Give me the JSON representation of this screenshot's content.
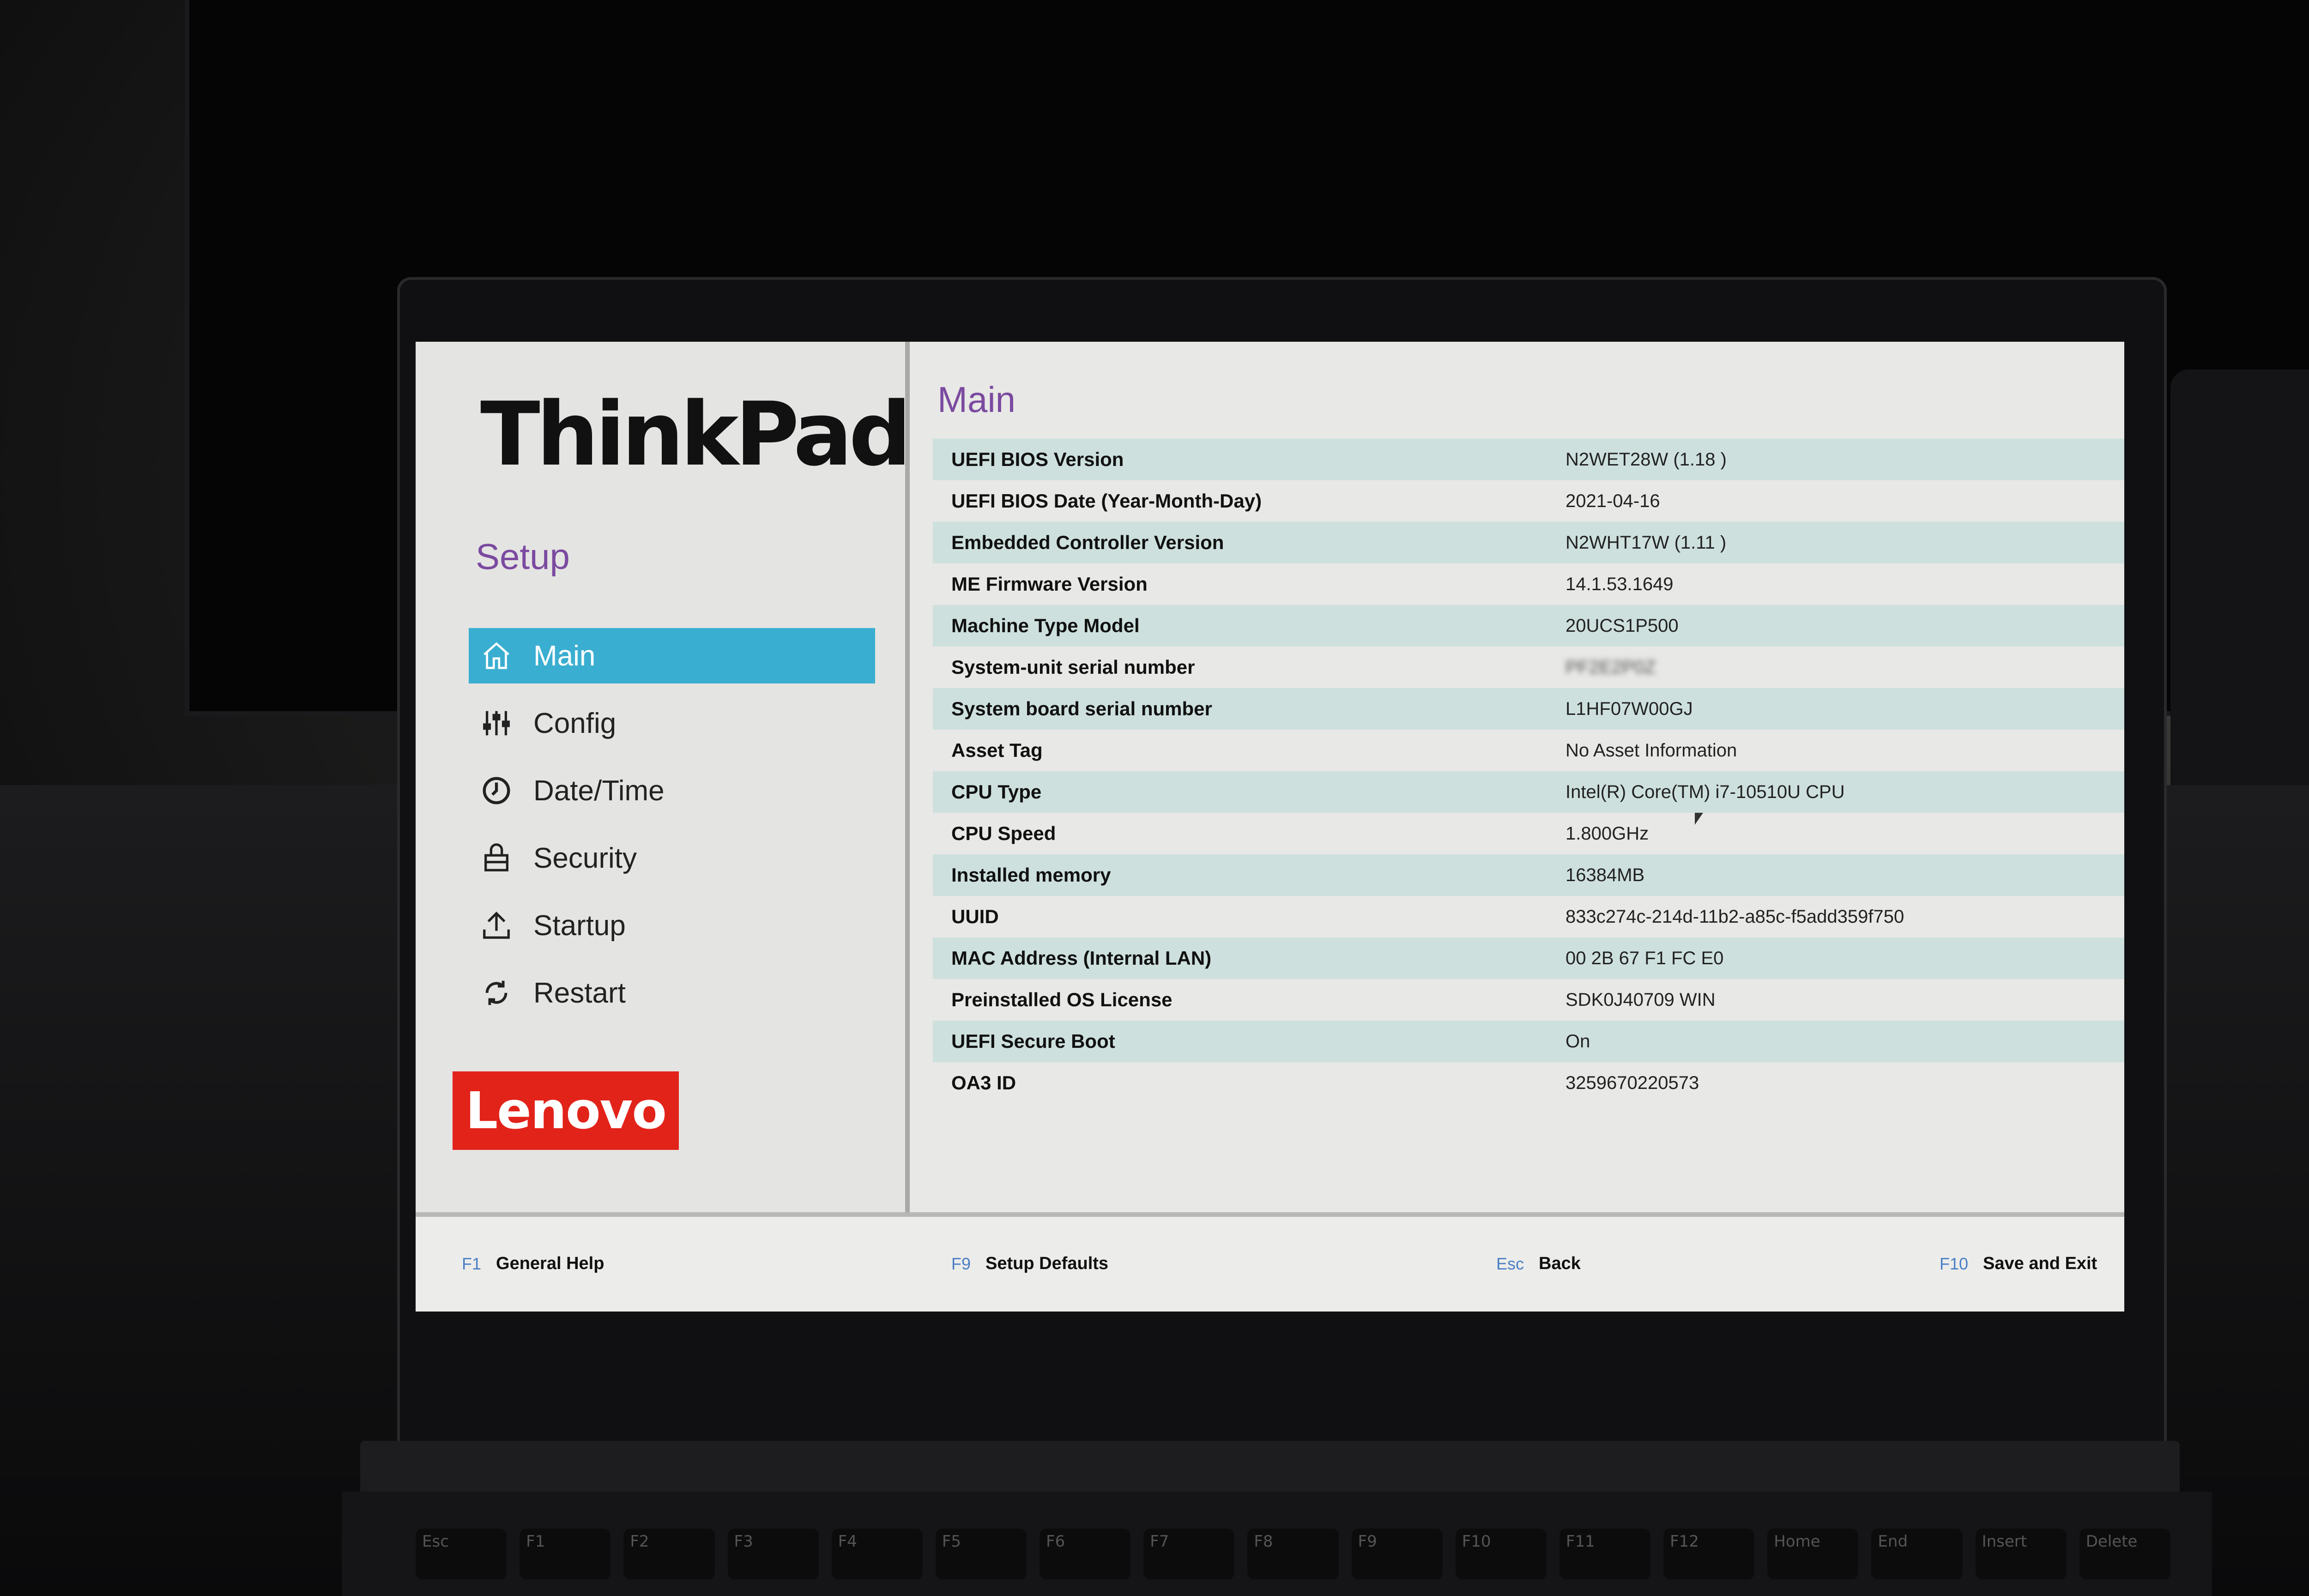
{
  "brand": {
    "name": "ThinkPad",
    "manufacturer_logo": "Lenovo"
  },
  "sidebar": {
    "title": "Setup",
    "items": [
      {
        "label": "Main",
        "icon": "home-icon",
        "active": true
      },
      {
        "label": "Config",
        "icon": "sliders-icon",
        "active": false
      },
      {
        "label": "Date/Time",
        "icon": "clock-icon",
        "active": false
      },
      {
        "label": "Security",
        "icon": "lock-icon",
        "active": false
      },
      {
        "label": "Startup",
        "icon": "upload-icon",
        "active": false
      },
      {
        "label": "Restart",
        "icon": "restart-icon",
        "active": false
      }
    ]
  },
  "main": {
    "title": "Main",
    "rows": [
      {
        "label": "UEFI BIOS Version",
        "value": "N2WET28W (1.18 )"
      },
      {
        "label": "UEFI BIOS Date (Year-Month-Day)",
        "value": "2021-04-16"
      },
      {
        "label": "Embedded Controller Version",
        "value": "N2WHT17W (1.11 )"
      },
      {
        "label": "ME Firmware Version",
        "value": "14.1.53.1649"
      },
      {
        "label": "Machine Type Model",
        "value": "20UCS1P500"
      },
      {
        "label": "System-unit serial number",
        "value": "PF2E2P0Z",
        "redacted": true
      },
      {
        "label": "System board serial number",
        "value": "L1HF07W00GJ"
      },
      {
        "label": "Asset Tag",
        "value": "No Asset Information"
      },
      {
        "label": "CPU Type",
        "value": "Intel(R) Core(TM) i7-10510U CPU"
      },
      {
        "label": "CPU Speed",
        "value": "1.800GHz"
      },
      {
        "label": "Installed memory",
        "value": "16384MB"
      },
      {
        "label": "UUID",
        "value": "833c274c-214d-11b2-a85c-f5add359f750"
      },
      {
        "label": "MAC Address (Internal LAN)",
        "value": "00 2B 67 F1 FC E0"
      },
      {
        "label": "Preinstalled OS License",
        "value": "SDK0J40709 WIN"
      },
      {
        "label": "UEFI Secure Boot",
        "value": "On"
      },
      {
        "label": "OA3 ID",
        "value": "3259670220573"
      }
    ]
  },
  "footer": {
    "hints": [
      {
        "key": "F1",
        "label": "General Help"
      },
      {
        "key": "F9",
        "label": "Setup Defaults"
      },
      {
        "key": "Esc",
        "label": "Back"
      },
      {
        "key": "F10",
        "label": "Save and Exit"
      }
    ]
  },
  "keyboard": {
    "keys": [
      "Esc",
      "F1",
      "F2",
      "F3",
      "F4",
      "F5",
      "F6",
      "F7",
      "F8",
      "F9",
      "F10",
      "F11",
      "F12",
      "Home",
      "End",
      "Insert",
      "Delete"
    ]
  },
  "colors": {
    "accent_purple": "#7b4aa0",
    "active_nav": "#3aaed0",
    "row_shade": "#cde0dd",
    "lenovo_red": "#e2231a",
    "fkey_blue": "#4a7ec4"
  }
}
